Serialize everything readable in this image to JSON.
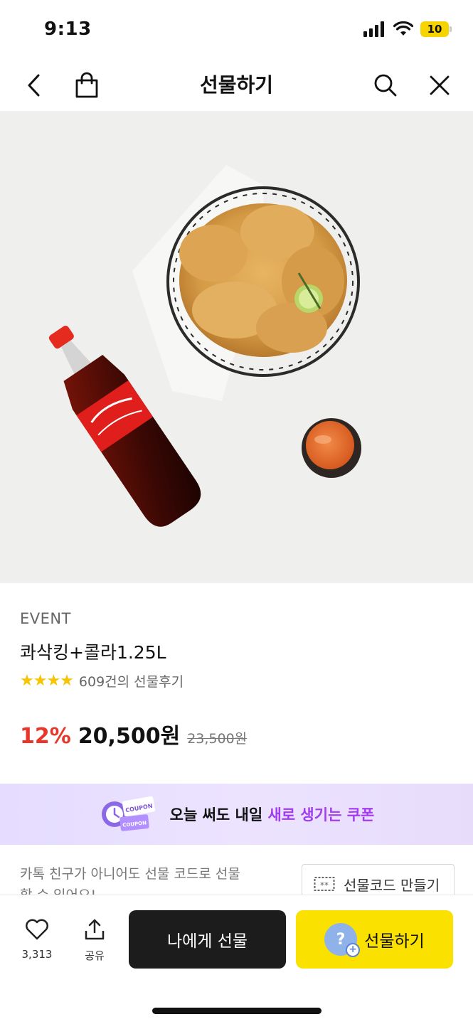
{
  "status": {
    "time": "9:13",
    "battery": "10"
  },
  "header": {
    "title": "선물하기"
  },
  "product": {
    "tag": "EVENT",
    "name": "콰삭킹+콜라1.25L",
    "stars": "★★★★",
    "reviews": "609건의 선물후기",
    "discount": "12%",
    "price": "20,500원",
    "original_price": "23,500원"
  },
  "coupon": {
    "text": "오늘 써도 내일",
    "highlight": "새로 생기는 쿠폰",
    "stamp_top": "COUPON",
    "stamp_bottom": "COUPON"
  },
  "giftcode": {
    "note": "카톡 친구가 아니어도 선물 코드로 선물 할 수 있어요!",
    "button_label": "선물코드 만들기",
    "button_icon_text": "**"
  },
  "bottom_bar": {
    "like_count": "3,313",
    "share_label": "공유",
    "gift_self_label": "나에게 선물",
    "gift_label": "선물하기",
    "gift_badge_symbol": "?",
    "gift_badge_plus": "+"
  },
  "colors": {
    "accent_yellow": "#fae100",
    "discount_red": "#e8362b",
    "coupon_purple": "#a33bf0",
    "dark_button": "#1c1c1c"
  }
}
